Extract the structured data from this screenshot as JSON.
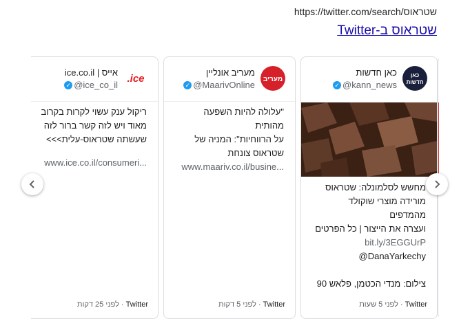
{
  "header": {
    "url": "https://twitter.com/search/שטראוס",
    "title": "שטראוס ב-Twitter"
  },
  "cards": [
    {
      "name": "כאן חדשות",
      "handle": "@kann_news",
      "avatar_text": "כאן חדשות",
      "text_lines": [
        "מחשש לסלמונלה: שטראוס",
        "מורידה מוצרי שוקולד מהמדפים",
        "ועצרה את הייצור | כל הפרטים"
      ],
      "link": "bit.ly/3EGGUrP",
      "mention": "@DanaYarkechy",
      "credit": "צילום: מנדי הכטמן, פלאש 90",
      "source": "Twitter",
      "time": "לפני 5 שעות"
    },
    {
      "name": "מעריב אונליין",
      "handle": "@MaarivOnline",
      "avatar_text": "מעריב",
      "text_lines": [
        "\"עלולה להיות השפעה מהותית",
        "על הרווחיות\": המניה של",
        "שטראוס צונחת"
      ],
      "link": "www.maariv.co.il/busine...",
      "source": "Twitter",
      "time": "לפני 5 דקות"
    },
    {
      "name": "אייס | ice.co.il",
      "handle": "@ice_co_il",
      "avatar_text": "ice.",
      "text_lines": [
        "ריקול ענק עשוי לקרות בקרוב",
        "מאוד ויש לזה קשר ברור לזה",
        "שעשתה שטראוס-עלית>>>"
      ],
      "link": "www.ice.co.il/consumeri...",
      "source": "Twitter",
      "time": "לפני 25 דקות"
    }
  ],
  "nav": {
    "prev_icon": "chevron-left-icon",
    "next_icon": "chevron-right-icon"
  },
  "colors": {
    "link": "#1a0dab",
    "verified": "#1d9bf0",
    "kann_avatar": "#1a1f3c",
    "maariv_avatar": "#d6202a",
    "ice_avatar": "#e31e24"
  }
}
